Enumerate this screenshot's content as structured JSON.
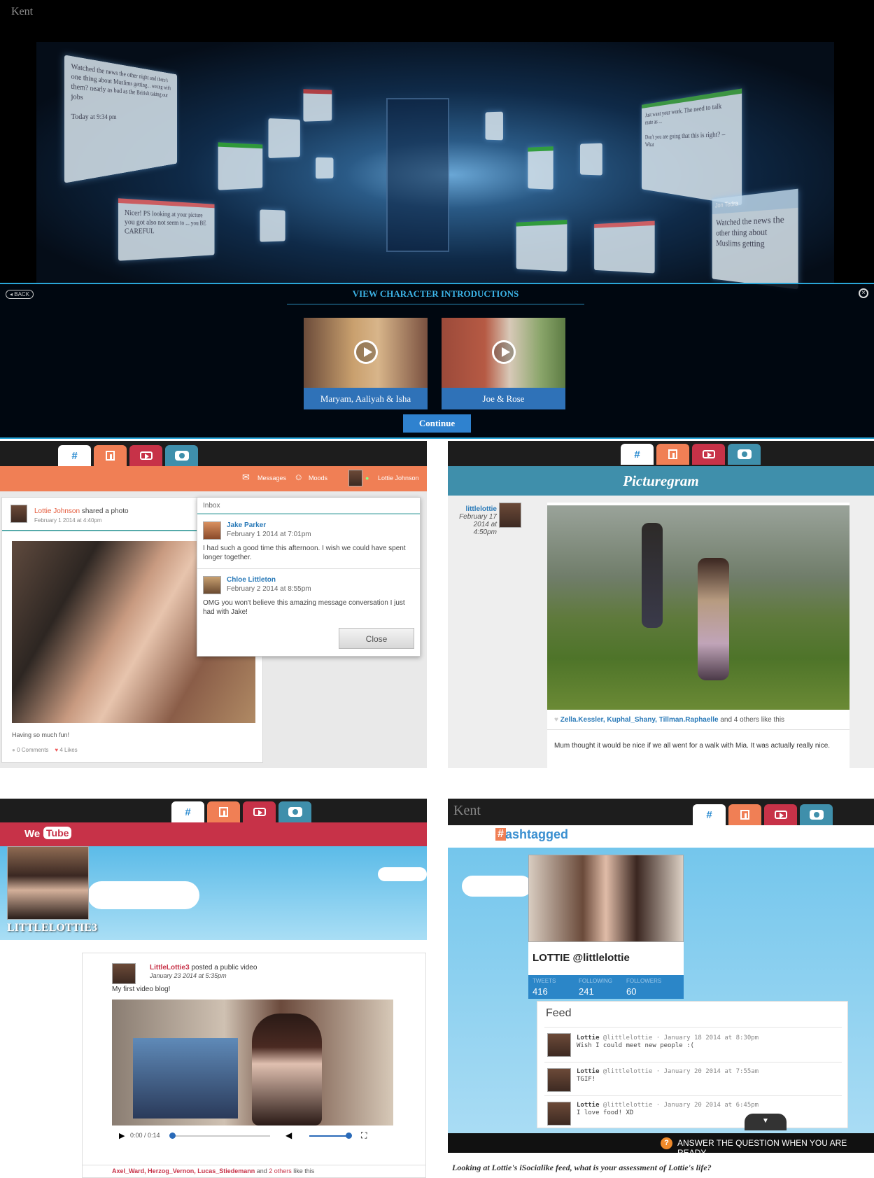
{
  "top_panel": {
    "logo": "Kent",
    "back_label": "BACK",
    "close_glyph": "×",
    "title": "VIEW CHARACTER INTRODUCTIONS",
    "videos": [
      {
        "label": "Maryam, Aaliyah & Isha"
      },
      {
        "label": "Joe & Rose"
      }
    ],
    "continue_label": "Continue",
    "floating_texts": [
      "Watched the news the other night and there's one thing about Muslims getting... wrong with them? nearly as bad as the British taking our jobs",
      "Today at 9:34 pm",
      "Nicer! PS looking at your picture you got also not seem to ... you BE CAREFUL",
      "Just want your work. The need to talk mate as ...",
      "Don't you are going that this is right? – What",
      "Watched the news the other thing about Muslims getting"
    ],
    "floating_names": [
      "Jon Tedra"
    ]
  },
  "tabs": {
    "hash": "#"
  },
  "facebook": {
    "nav": {
      "messages": "Messages",
      "moods": "Moods",
      "user": "Lottie Johnson"
    },
    "post": {
      "author": "Lottie Johnson",
      "action": " shared a photo",
      "date": "February 1 2014 at 4:40pm",
      "caption": "Having so much fun!",
      "comments": "0 Comments",
      "likes": "4 Likes"
    },
    "inbox": {
      "title": "Inbox",
      "messages": [
        {
          "name": "Jake Parker",
          "date": "February 1 2014 at 7:01pm",
          "text": "I had such a good time this afternoon. I wish we could have spent longer together."
        },
        {
          "name": "Chloe Littleton",
          "date": "February 2 2014 at 8:55pm",
          "text": "OMG you won't believe this amazing message conversation I just had with Jake!"
        }
      ],
      "close_label": "Close"
    }
  },
  "picturegram": {
    "brand": "Picturegram",
    "user": "littlelottie",
    "date_lines": [
      "February 17",
      "2014 at",
      "4:50pm"
    ],
    "likes_names": "Zella.Kessler, Kuphal_Shany, Tillman.Raphaelle",
    "likes_rest": " and 4 others like this",
    "caption": "Mum thought it would be nice if we all went for a walk with Mia. It was actually really nice."
  },
  "wetube": {
    "brand_we": "We",
    "brand_tube": "Tube",
    "channel": "LITTLELOTTIE3",
    "author": "LittleLottie3",
    "action": " posted a public video",
    "date": "January 23 2014 at 5:35pm",
    "title": "My first video blog!",
    "time": "0:00 / 0:14",
    "likes_names": "Axel_Ward, Herzog_Vernon, Lucas_Stiedemann",
    "likes_mid": " and ",
    "likes_others": "2 others",
    "likes_rest": " like this"
  },
  "hashtagged": {
    "logo": "Kent",
    "brand_hash": "#",
    "brand_rest": "ashtagged",
    "profile_name": "LOTTIE @littlelottie",
    "stats": [
      {
        "label": "TWEETS",
        "value": "416"
      },
      {
        "label": "FOLLOWING",
        "value": "241"
      },
      {
        "label": "FOLLOWERS",
        "value": "60"
      }
    ],
    "feed_title": "Feed",
    "feed": [
      {
        "name": "Lottie",
        "meta": " @littlelottie · January 18 2014 at 8:30pm",
        "text": "Wish I could meet new people :("
      },
      {
        "name": "Lottie",
        "meta": " @littlelottie · January 20 2014 at 7:55am",
        "text": "TGIF!"
      },
      {
        "name": "Lottie",
        "meta": " @littlelottie · January 20 2014 at 6:45pm",
        "text": "I love food! XD"
      }
    ],
    "question_bar": "ANSWER THE QUESTION WHEN YOU ARE READY",
    "question_icon": "?",
    "question": "Looking at Lottie's iSocialike feed, what is your assessment of Lottie's life?"
  }
}
